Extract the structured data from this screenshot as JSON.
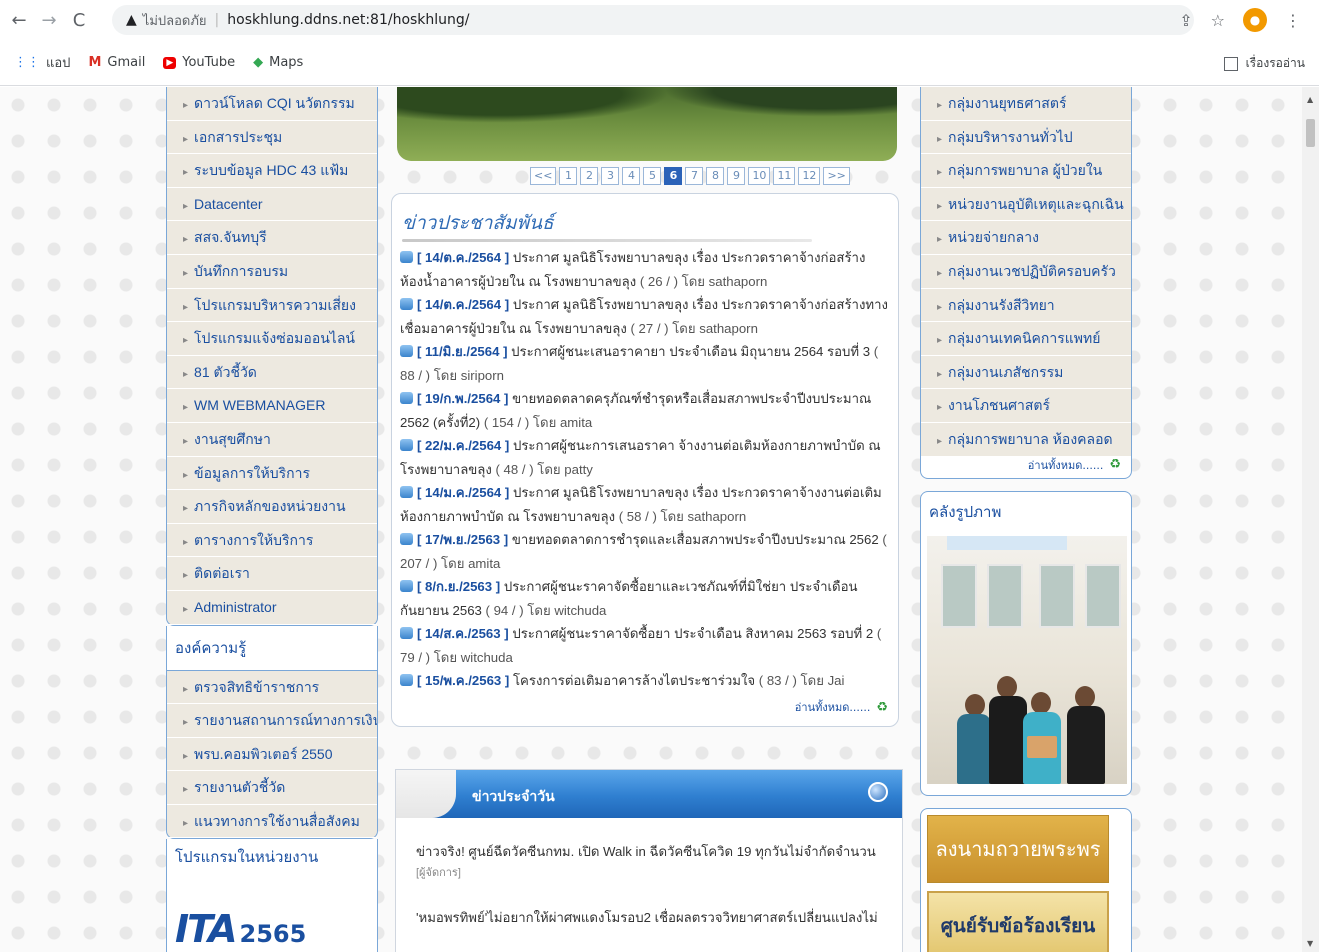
{
  "browser": {
    "security_label": "ไม่ปลอดภัย",
    "url": "hoskhlung.ddns.net:81/hoskhlung/",
    "bookmarks": [
      "แอป",
      "Gmail",
      "YouTube",
      "Maps"
    ],
    "reading_list": "เรื่องรออ่าน"
  },
  "left_menu": {
    "items": [
      "ดาวน์โหลด CQI นวัตกรรม",
      "เอกสารประชุม",
      "ระบบข้อมูล HDC 43 แฟ้ม",
      "Datacenter",
      "สสจ.จันทบุรี",
      "บันทึกการอบรม",
      "โปรแกรมบริหารความเสี่ยง",
      "โปรแกรมแจ้งซ่อมออนไลน์",
      "81 ตัวชี้วัด",
      "WM WEBMANAGER",
      "งานสุขศึกษา",
      "ข้อมูลการให้บริการ",
      "ภารกิจหลักของหน่วยงาน",
      "ตารางการให้บริการ",
      "ติดต่อเรา",
      "Administrator"
    ],
    "knowledge_title": "องค์ความรู้",
    "knowledge_items": [
      "ตรวจสิทธิข้าราชการ",
      "รายงานสถานการณ์ทางการเงิน",
      "พรบ.คอมพิวเตอร์ 2550",
      "รายงานตัวชี้วัด",
      "แนวทางการใช้งานสื่อสังคม"
    ],
    "programs_title": "โปรแกรมในหน่วยงาน",
    "ita_text": "ITA",
    "ita_year": "2565"
  },
  "pager": {
    "prev": "<<",
    "pages": [
      "1",
      "2",
      "3",
      "4",
      "5",
      "6",
      "7",
      "8",
      "9",
      "10",
      "11",
      "12"
    ],
    "active": "6",
    "next": ">>"
  },
  "news": {
    "title": "ข่าวประชาสัมพันธ์",
    "items": [
      {
        "date": "[ 14/ต.ค./2564 ]",
        "text": " ประกาศ มูลนิธิโรงพยาบาลขลุง เรื่อง ประกวดราคาจ้างก่อสร้างห้องน้ำอาคารผู้ป่วยใน ณ โรงพยาบาลขลุง",
        "meta": " ( 26 / ) โดย sathaporn"
      },
      {
        "date": "[ 14/ต.ค./2564 ]",
        "text": " ประกาศ มูลนิธิโรงพยาบาลขลุง เรื่อง ประกวดราคาจ้างก่อสร้างทางเชื่อมอาคารผู้ป่วยใน ณ โรงพยาบาลขลุง",
        "meta": " ( 27 / ) โดย sathaporn"
      },
      {
        "date": "[ 11/มิ.ย./2564 ]",
        "text": " ประกาศผู้ชนะเสนอราคายา ประจำเดือน มิถุนายน 2564 รอบที่ 3",
        "meta": " ( 88 / ) โดย siriporn"
      },
      {
        "date": "[ 19/ก.พ./2564 ]",
        "text": " ขายทอดตลาดครุภัณฑ์ชำรุดหรือเสื่อมสภาพประจำปีงบประมาณ 2562 (ครั้งที่2)",
        "meta": " ( 154 / ) โดย amita"
      },
      {
        "date": "[ 22/ม.ค./2564 ]",
        "text": " ประกาศผู้ชนะการเสนอราคา จ้างงานต่อเติมห้องกายภาพบำบัด ณ โรงพยาบาลขลุง",
        "meta": " ( 48 / ) โดย patty"
      },
      {
        "date": "[ 14/ม.ค./2564 ]",
        "text": " ประกาศ มูลนิธิโรงพยาบาลขลุง เรื่อง ประกวดราคาจ้างงานต่อเติมห้องกายภาพบำบัด ณ โรงพยาบาลขลุง",
        "meta": " ( 58 / ) โดย sathaporn"
      },
      {
        "date": "[ 17/พ.ย./2563 ]",
        "text": " ขายทอดตลาดการชำรุดและเสื่อมสภาพประจำปีงบประมาณ 2562",
        "meta": " ( 207 / ) โดย amita"
      },
      {
        "date": "[ 8/ก.ย./2563 ]",
        "text": " ประกาศผู้ชนะราคาจัดซื้อยาและเวชภัณฑ์ที่มิใช่ยา ประจำเดือน กันยายน 2563",
        "meta": " ( 94 / ) โดย witchuda"
      },
      {
        "date": "[ 14/ส.ค./2563 ]",
        "text": " ประกาศผู้ชนะราคาจัดซื้อยา ประจำเดือน สิงหาคม 2563 รอบที่ 2",
        "meta": " ( 79 / ) โดย witchuda"
      },
      {
        "date": "[ 15/พ.ค./2563 ]",
        "text": " โครงการต่อเติมอาคารล้างไตประชาร่วมใจ",
        "meta": " ( 83 / ) โดย Jai"
      }
    ],
    "read_all": "อ่านทั้งหมด......"
  },
  "daily": {
    "title": "ข่าวประจำวัน",
    "item1": "ข่าวจริง! ศูนย์ฉีดวัคซีนกทม. เปิด Walk in ฉีดวัคซีนโควิด 19 ทุกวันไม่จำกัดจำนวน",
    "item1_src": "[ผู้จัดการ]",
    "item2": "'หมอพรทิพย์'ไม่อยากให้ผ่าศพแดงโมรอบ2 เชื่อผลตรวจวิทยาศาสตร์เปลี่ยนแปลงไม่"
  },
  "right_menu": {
    "items": [
      "กลุ่มงานยุทธศาสตร์",
      "กลุ่มบริหารงานทั่วไป",
      "กลุ่มการพยาบาล ผู้ป่วยใน",
      "หน่วยงานอุบัติเหตุและฉุกเฉิน",
      "หน่วยจ่ายกลาง",
      "กลุ่มงานเวชปฏิบัติครอบครัว",
      "กลุ่มงานรังสีวิทยา",
      "กลุ่มงานเทคนิคการแพทย์",
      "กลุ่มงานเภสัชกรรม",
      "งานโภชนศาสตร์",
      "กลุ่มการพยาบาล ห้องคลอด"
    ],
    "read_all": "อ่านทั้งหมด......",
    "gallery_title": "คลังรูปภาพ",
    "banner1": "ลงนามถวายพระพร",
    "banner2": "ศูนย์รับข้อร้องเรียน"
  }
}
